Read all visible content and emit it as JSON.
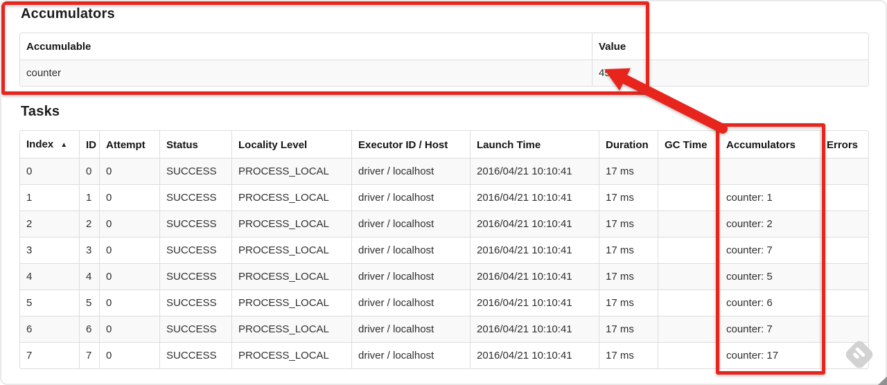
{
  "accumulators_section": {
    "heading": "Accumulators",
    "table": {
      "columns": [
        "Accumulable",
        "Value"
      ],
      "rows": [
        {
          "accumulable": "counter",
          "value": "45"
        }
      ]
    }
  },
  "tasks_section": {
    "heading": "Tasks",
    "table": {
      "columns": [
        "Index",
        "ID",
        "Attempt",
        "Status",
        "Locality Level",
        "Executor ID / Host",
        "Launch Time",
        "Duration",
        "GC Time",
        "Accumulators",
        "Errors"
      ],
      "sort_icon": "▲",
      "rows": [
        {
          "index": "0",
          "id": "0",
          "attempt": "0",
          "status": "SUCCESS",
          "locality_level": "PROCESS_LOCAL",
          "executor_id_host": "driver / localhost",
          "launch_time": "2016/04/21 10:10:41",
          "duration": "17 ms",
          "gc_time": "",
          "accumulators": "",
          "errors": ""
        },
        {
          "index": "1",
          "id": "1",
          "attempt": "0",
          "status": "SUCCESS",
          "locality_level": "PROCESS_LOCAL",
          "executor_id_host": "driver / localhost",
          "launch_time": "2016/04/21 10:10:41",
          "duration": "17 ms",
          "gc_time": "",
          "accumulators": "counter: 1",
          "errors": ""
        },
        {
          "index": "2",
          "id": "2",
          "attempt": "0",
          "status": "SUCCESS",
          "locality_level": "PROCESS_LOCAL",
          "executor_id_host": "driver / localhost",
          "launch_time": "2016/04/21 10:10:41",
          "duration": "17 ms",
          "gc_time": "",
          "accumulators": "counter: 2",
          "errors": ""
        },
        {
          "index": "3",
          "id": "3",
          "attempt": "0",
          "status": "SUCCESS",
          "locality_level": "PROCESS_LOCAL",
          "executor_id_host": "driver / localhost",
          "launch_time": "2016/04/21 10:10:41",
          "duration": "17 ms",
          "gc_time": "",
          "accumulators": "counter: 7",
          "errors": ""
        },
        {
          "index": "4",
          "id": "4",
          "attempt": "0",
          "status": "SUCCESS",
          "locality_level": "PROCESS_LOCAL",
          "executor_id_host": "driver / localhost",
          "launch_time": "2016/04/21 10:10:41",
          "duration": "17 ms",
          "gc_time": "",
          "accumulators": "counter: 5",
          "errors": ""
        },
        {
          "index": "5",
          "id": "5",
          "attempt": "0",
          "status": "SUCCESS",
          "locality_level": "PROCESS_LOCAL",
          "executor_id_host": "driver / localhost",
          "launch_time": "2016/04/21 10:10:41",
          "duration": "17 ms",
          "gc_time": "",
          "accumulators": "counter: 6",
          "errors": ""
        },
        {
          "index": "6",
          "id": "6",
          "attempt": "0",
          "status": "SUCCESS",
          "locality_level": "PROCESS_LOCAL",
          "executor_id_host": "driver / localhost",
          "launch_time": "2016/04/21 10:10:41",
          "duration": "17 ms",
          "gc_time": "",
          "accumulators": "counter: 7",
          "errors": ""
        },
        {
          "index": "7",
          "id": "7",
          "attempt": "0",
          "status": "SUCCESS",
          "locality_level": "PROCESS_LOCAL",
          "executor_id_host": "driver / localhost",
          "launch_time": "2016/04/21 10:10:41",
          "duration": "17 ms",
          "gc_time": "",
          "accumulators": "counter: 17",
          "errors": ""
        }
      ]
    }
  },
  "annotations": {
    "color": "#e8251c",
    "boxes": [
      "accumulators-section-highlight",
      "tasks-accumulators-column-highlight"
    ],
    "arrow_points_to": "45"
  },
  "colors": {
    "row_stripe": "#f9f9f9",
    "table_border": "#dddddd",
    "watermark_gray": "#d2d2d2"
  }
}
